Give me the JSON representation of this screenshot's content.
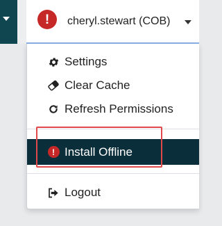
{
  "header": {
    "user_label": "cheryl.stewart (COB)",
    "alert_icon": "alert-circle-icon",
    "accent_color": "#0f4650",
    "alert_color": "#c62828"
  },
  "menu": {
    "settings": "Settings",
    "clear_cache": "Clear Cache",
    "refresh_permissions": "Refresh Permissions",
    "install_offline": "Install Offline",
    "logout": "Logout"
  },
  "highlight": {
    "color": "#e0484a",
    "target": "Install Offline"
  }
}
